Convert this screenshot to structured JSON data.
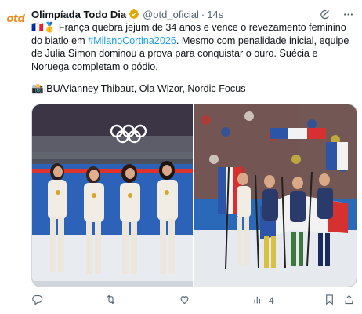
{
  "account": {
    "avatar_text": "otd",
    "name": "Olimpíada Todo Dia",
    "handle": "@otd_oficial",
    "separator": "·",
    "time": "14s"
  },
  "post": {
    "flags": "🇫🇷🥇",
    "text_part1": "França quebra jejum de 34 anos e vence o revezamento feminino do biatlo em ",
    "hashtag": "#MilanoCortina2026",
    "text_part2": ". Mesmo com penalidade inicial, equipe de Julia Simon dominou a prova para conquistar o ouro. Suécia e Noruega completam o pódio.",
    "credit_icon": "📸",
    "credit": "IBU/Vianney Thibaut, Ola Wizor, Nordic Focus"
  },
  "icons": {
    "grok": "grok-icon",
    "more": "more-icon",
    "reply": "reply-icon",
    "repost": "repost-icon",
    "like": "like-icon",
    "views": "views-icon",
    "bookmark": "bookmark-icon",
    "share": "share-icon"
  },
  "actions": {
    "views_count": "4"
  },
  "colors": {
    "accent": "#1d9bf0",
    "brand": "#f08a18",
    "secondary_text": "#536471"
  }
}
